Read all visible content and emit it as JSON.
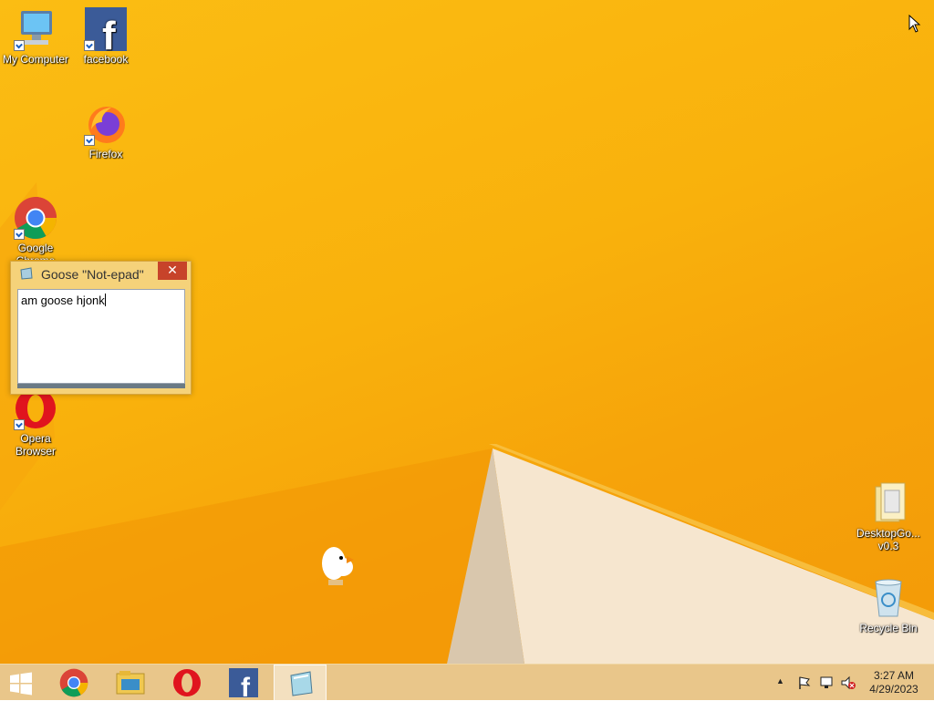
{
  "desktop": {
    "icons": [
      {
        "label": "My Computer"
      },
      {
        "label": "facebook"
      },
      {
        "label": "Firefox"
      },
      {
        "label": "Google Chrome"
      },
      {
        "label": "Opera Browser"
      },
      {
        "label": "DesktopGo... v0.3"
      },
      {
        "label": "Recycle Bin"
      }
    ]
  },
  "notepad": {
    "title": "Goose \"Not-epad\"",
    "close_glyph": "✕",
    "content": "am goose hjonk"
  },
  "taskbar": {
    "start_icon": "windows-logo-icon",
    "pinned": [
      "chrome-icon",
      "file-explorer-icon",
      "opera-icon",
      "facebook-icon",
      "notepad-icon"
    ],
    "tray_arrow": "▲"
  },
  "clock": {
    "time": "3:27 AM",
    "date": "4/29/2023"
  },
  "colors": {
    "wallpaper": "#f9b10c",
    "taskbar": "#e9c68a",
    "close_button": "#c7432a"
  }
}
